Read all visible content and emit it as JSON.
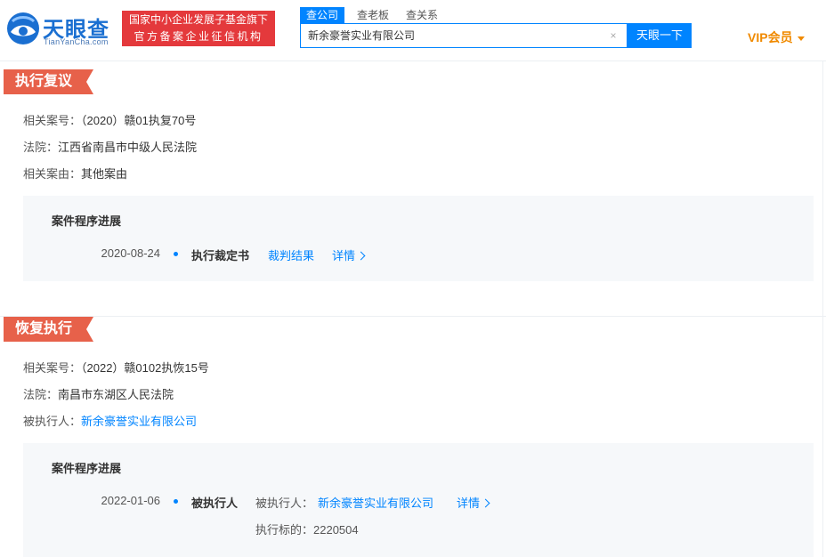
{
  "header": {
    "logo_text": "天眼查",
    "logo_sub": "TianYanCha.com",
    "gov_badge": [
      "国家中小企业发展子基金旗下",
      "官方备案企业征信机构"
    ],
    "search_tabs": [
      "查公司",
      "查老板",
      "查关系"
    ],
    "search_value": "新余豪誉实业有限公司",
    "search_button": "天眼一下",
    "vip_label": "VIP会员"
  },
  "sections": [
    {
      "tag": "执行复议",
      "fields": [
        {
          "label": "相关案号：",
          "value": "（2020）赣01执复70号"
        },
        {
          "label": "法院：",
          "value": "江西省南昌市中级人民法院"
        },
        {
          "label": "相关案由：",
          "value": "其他案由"
        }
      ],
      "progress": {
        "title": "案件程序进展",
        "date": "2020-08-24",
        "event": "执行裁定书",
        "link1": "裁判结果",
        "link2": "详情"
      }
    },
    {
      "tag": "恢复执行",
      "fields": [
        {
          "label": "相关案号：",
          "value": "（2022）赣0102执恢15号"
        },
        {
          "label": "法院：",
          "value": "南昌市东湖区人民法院"
        },
        {
          "label": "被执行人：",
          "value": "新余豪誉实业有限公司"
        }
      ],
      "progress": {
        "title": "案件程序进展",
        "date": "2022-01-06",
        "event": "被执行人",
        "party_label": "被执行人：",
        "party_value": "新余豪誉实业有限公司",
        "link2": "详情",
        "target_label": "执行标的：",
        "target_value": "2220504"
      }
    }
  ]
}
